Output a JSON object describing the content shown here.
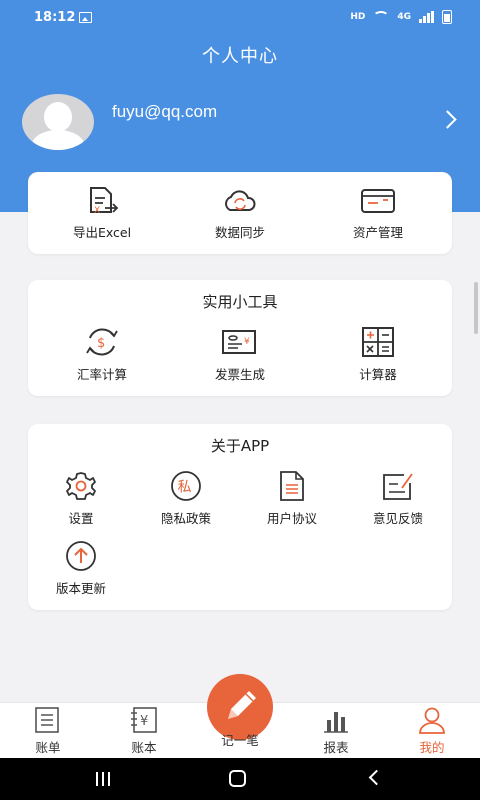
{
  "status": {
    "time": "18:12",
    "hd": "HD",
    "net": "4G"
  },
  "header": {
    "title": "个人中心",
    "email": "fuyu@qq.com"
  },
  "quick": [
    {
      "label": "导出Excel",
      "icon": "export-excel-icon"
    },
    {
      "label": "数据同步",
      "icon": "cloud-sync-icon"
    },
    {
      "label": "资产管理",
      "icon": "card-asset-icon"
    }
  ],
  "tools": {
    "title": "实用小工具",
    "items": [
      {
        "label": "汇率计算",
        "icon": "exchange-rate-icon"
      },
      {
        "label": "发票生成",
        "icon": "invoice-icon"
      },
      {
        "label": "计算器",
        "icon": "calculator-icon"
      }
    ]
  },
  "about": {
    "title": "关于APP",
    "items": [
      {
        "label": "设置",
        "icon": "gear-icon"
      },
      {
        "label": "隐私政策",
        "icon": "privacy-icon",
        "glyph": "私"
      },
      {
        "label": "用户协议",
        "icon": "document-icon"
      },
      {
        "label": "意见反馈",
        "icon": "feedback-icon"
      },
      {
        "label": "版本更新",
        "icon": "update-arrow-icon"
      }
    ]
  },
  "tabbar": {
    "tabs": [
      {
        "label": "账单",
        "icon": "bill-icon"
      },
      {
        "label": "账本",
        "icon": "ledger-icon"
      },
      {
        "label": "记一笔",
        "icon": "pencil-icon"
      },
      {
        "label": "报表",
        "icon": "bar-chart-icon"
      },
      {
        "label": "我的",
        "icon": "user-icon",
        "active": true
      }
    ]
  },
  "colors": {
    "primary": "#4a90e2",
    "accent": "#e8643a",
    "icon": "#333333"
  }
}
